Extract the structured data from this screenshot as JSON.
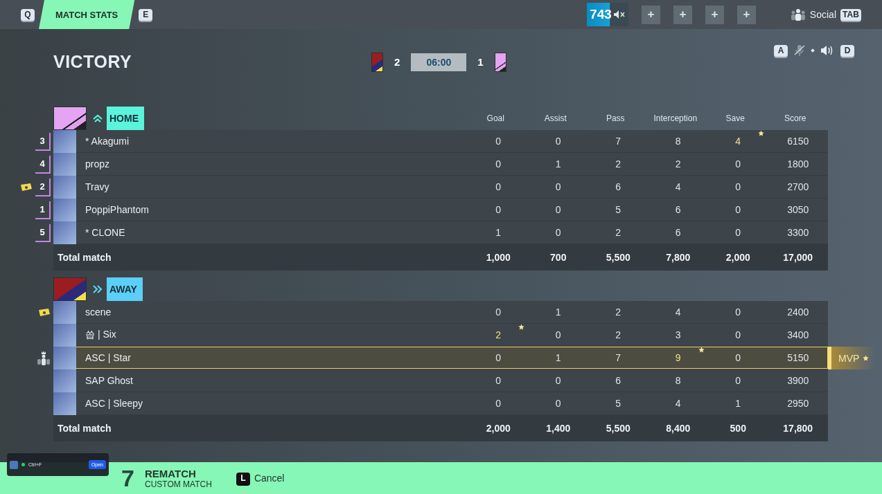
{
  "top_bar": {
    "prev_key": "Q",
    "tab": "MATCH STATS",
    "next_key": "E",
    "level": "743",
    "slots": [
      "+",
      "+",
      "+",
      "+"
    ],
    "social": "Social",
    "social_key": "TAB"
  },
  "voice": {
    "left_key": "A",
    "right_key": "D"
  },
  "result": "VICTORY",
  "scoreboard": {
    "home_score": "2",
    "clock": "06:00",
    "away_score": "1"
  },
  "columns": [
    "Goal",
    "Assist",
    "Pass",
    "Interception",
    "Save",
    "Score"
  ],
  "teams": [
    {
      "kind": "home",
      "name": "HOME",
      "total_label": "Total match",
      "totals": [
        "1,000",
        "700",
        "5,500",
        "7,800",
        "2,000",
        "17,000"
      ],
      "players": [
        {
          "rank": "3",
          "name": "* Akagumi",
          "kind": "plain",
          "selected": false,
          "stats": [
            {
              "value": "0",
              "best": false
            },
            {
              "value": "0",
              "best": false
            },
            {
              "value": "7",
              "best": false
            },
            {
              "value": "8",
              "best": false
            },
            {
              "value": "4",
              "best": true
            },
            {
              "value": "6150",
              "best": false
            }
          ]
        },
        {
          "rank": "4",
          "name": "propz",
          "kind": "plain",
          "selected": false,
          "stats": [
            {
              "value": "0",
              "best": false
            },
            {
              "value": "1",
              "best": false
            },
            {
              "value": "2",
              "best": false
            },
            {
              "value": "2",
              "best": false
            },
            {
              "value": "0",
              "best": false
            },
            {
              "value": "1800",
              "best": false
            }
          ]
        },
        {
          "rank": "2",
          "name": "Travy",
          "kind": "ticket",
          "selected": false,
          "stats": [
            {
              "value": "0",
              "best": false
            },
            {
              "value": "0",
              "best": false
            },
            {
              "value": "6",
              "best": false
            },
            {
              "value": "4",
              "best": false
            },
            {
              "value": "0",
              "best": false
            },
            {
              "value": "2700",
              "best": false
            }
          ]
        },
        {
          "rank": "1",
          "name": "PoppiPhantom",
          "kind": "plain",
          "selected": false,
          "stats": [
            {
              "value": "0",
              "best": false
            },
            {
              "value": "0",
              "best": false
            },
            {
              "value": "5",
              "best": false
            },
            {
              "value": "6",
              "best": false
            },
            {
              "value": "0",
              "best": false
            },
            {
              "value": "3050",
              "best": false
            }
          ]
        },
        {
          "rank": "5",
          "name": "* CLONE",
          "kind": "plain",
          "selected": false,
          "stats": [
            {
              "value": "1",
              "best": false
            },
            {
              "value": "0",
              "best": false
            },
            {
              "value": "2",
              "best": false
            },
            {
              "value": "6",
              "best": false
            },
            {
              "value": "0",
              "best": false
            },
            {
              "value": "3300",
              "best": false
            }
          ]
        }
      ]
    },
    {
      "kind": "away",
      "name": "AWAY",
      "total_label": "Total match",
      "totals": [
        "2,000",
        "1,400",
        "5,500",
        "8,400",
        "500",
        "17,800"
      ],
      "players": [
        {
          "name": "scene",
          "kind": "ticket",
          "selected": false,
          "stats": [
            {
              "value": "0",
              "best": false
            },
            {
              "value": "1",
              "best": false
            },
            {
              "value": "2",
              "best": false
            },
            {
              "value": "4",
              "best": false
            },
            {
              "value": "0",
              "best": false
            },
            {
              "value": "2400",
              "best": false
            }
          ]
        },
        {
          "name": "씁 | Six",
          "kind": "plain",
          "selected": false,
          "stats": [
            {
              "value": "2",
              "best": true
            },
            {
              "value": "0",
              "best": false
            },
            {
              "value": "2",
              "best": false
            },
            {
              "value": "3",
              "best": false
            },
            {
              "value": "0",
              "best": false
            },
            {
              "value": "3400",
              "best": false
            }
          ]
        },
        {
          "name": "ASC | Star",
          "kind": "leader",
          "selected": true,
          "mvp": "MVP",
          "stats": [
            {
              "value": "0",
              "best": false
            },
            {
              "value": "1",
              "best": false
            },
            {
              "value": "7",
              "best": false
            },
            {
              "value": "9",
              "best": true
            },
            {
              "value": "0",
              "best": false
            },
            {
              "value": "5150",
              "best": false
            }
          ]
        },
        {
          "name": "SAP Ghost",
          "kind": "plain",
          "selected": false,
          "stats": [
            {
              "value": "0",
              "best": false
            },
            {
              "value": "0",
              "best": false
            },
            {
              "value": "6",
              "best": false
            },
            {
              "value": "8",
              "best": false
            },
            {
              "value": "0",
              "best": false
            },
            {
              "value": "3900",
              "best": false
            }
          ]
        },
        {
          "name": "ASC | Sleepy",
          "kind": "plain",
          "selected": false,
          "stats": [
            {
              "value": "0",
              "best": false
            },
            {
              "value": "0",
              "best": false
            },
            {
              "value": "5",
              "best": false
            },
            {
              "value": "4",
              "best": false
            },
            {
              "value": "1",
              "best": false
            },
            {
              "value": "2950",
              "best": false
            }
          ]
        }
      ]
    }
  ],
  "footer": {
    "count": "7",
    "title": "REMATCH",
    "subtitle": "CUSTOM MATCH",
    "cancel_key": "L",
    "cancel": "Cancel"
  },
  "overlay": {
    "shortcut": "Ctrl+F",
    "button": "Open"
  }
}
